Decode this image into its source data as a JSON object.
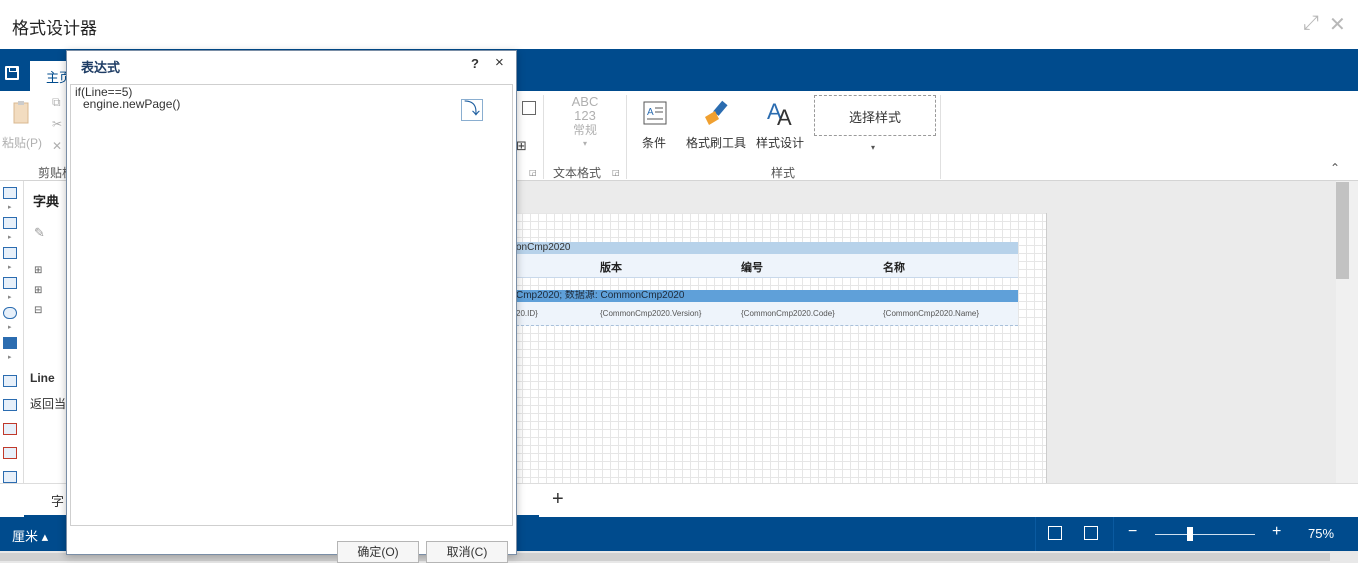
{
  "window": {
    "title": "格式设计器"
  },
  "ribbon": {
    "home_tab": "主页",
    "clipboard": {
      "paste_label": "粘贴(P)",
      "group_label": "剪贴板"
    },
    "text_format": {
      "preview_line1": "ABC",
      "preview_line2": "123",
      "preview_line3": "常规",
      "group_label": "文本格式"
    },
    "style": {
      "condition_label": "条件",
      "format_painter_label": "格式刷工具",
      "style_design_label": "样式设计",
      "select_style_label": "选择样式",
      "group_label": "样式"
    }
  },
  "dictionary": {
    "title": "字典",
    "item_name": "Line",
    "item_desc": "返回当",
    "bottom_tab": "字"
  },
  "report": {
    "band1_header": "onCmp2020",
    "band1_cells": [
      "版本",
      "编号",
      "名称"
    ],
    "band2_header": "Cmp2020; 数据源: CommonCmp2020",
    "band2_cells": [
      "20.ID}",
      "{CommonCmp2020.Version}",
      "{CommonCmp2020.Code}",
      "{CommonCmp2020.Name}"
    ]
  },
  "page_tabs": {
    "add_label": "+"
  },
  "status": {
    "unit": "厘米 ▴",
    "zoom_minus": "−",
    "zoom_plus": "+",
    "zoom_value": "75%",
    "zoom_fraction": 0.35
  },
  "dialog": {
    "title": "表达式",
    "help": "?",
    "close": "×",
    "expression_lines": [
      "if(Line==5)",
      "engine.newPage()"
    ],
    "ok_label": "确定(O)",
    "cancel_label": "取消(C)"
  }
}
